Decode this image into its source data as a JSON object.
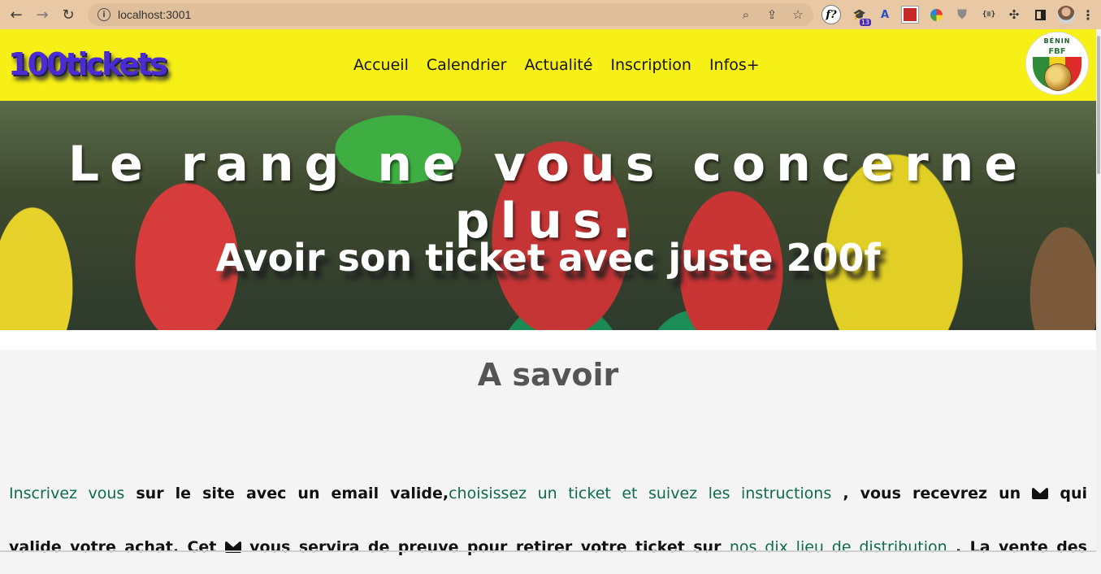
{
  "browser": {
    "url": "localhost:3001",
    "extension_badge": "13",
    "json_ext_label": "{≡}",
    "f_ext_label": "f?"
  },
  "header": {
    "logo": "100tickets",
    "menu": [
      "Accueil",
      "Calendrier",
      "Actualité",
      "Inscription",
      "Infos+"
    ],
    "crest_top": "BÉNIN",
    "crest_mid": "FBF",
    "bg_color": "#f7f016"
  },
  "hero": {
    "headline": "Le rang ne vous concerne plus.",
    "subheadline": "Avoir son ticket avec juste 200f"
  },
  "content": {
    "section_title": "A savoir",
    "line1": {
      "link1": "Inscrivez vous",
      "text1": " sur le site avec un email valide,",
      "link2": "choisissez un ticket et suivez les instructions",
      "text2": " , vous recevrez un ",
      "text3": " qui"
    },
    "line2": {
      "text1": "valide votre achat. Cet ",
      "text2": " vous servira de preuve pour retirer votre ticket sur ",
      "link1": "nos dix lieu de distribution",
      "text3": " . La vente des"
    },
    "link_color": "#0f6b4a"
  }
}
